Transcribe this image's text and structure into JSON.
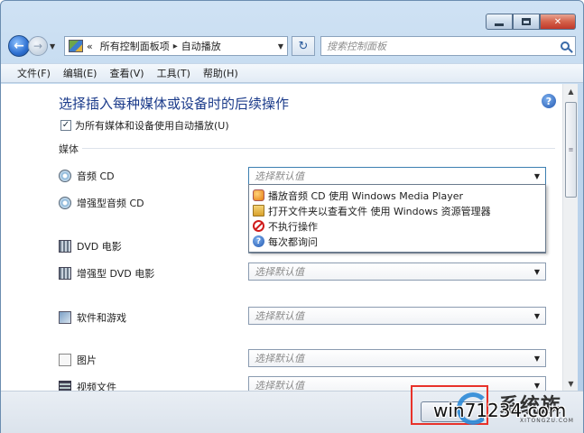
{
  "window": {
    "minimize_icon": "minimize-icon",
    "maximize_icon": "maximize-icon",
    "close_label": "✕"
  },
  "address_bar": {
    "overflow": "«",
    "crumb1": "所有控制面板项",
    "sep": "▸",
    "crumb2": "自动播放",
    "refresh": "↻",
    "search_placeholder": "搜索控制面板"
  },
  "menu": [
    "文件(F)",
    "编辑(E)",
    "查看(V)",
    "工具(T)",
    "帮助(H)"
  ],
  "main": {
    "heading": "选择插入每种媒体或设备时的后续操作",
    "help": "?",
    "autoplay_all_label": "为所有媒体和设备使用自动播放(U)",
    "autoplay_all_checked": true,
    "section_media": "媒体"
  },
  "rows": [
    {
      "label": "音频 CD",
      "value": "选择默认值",
      "icon": "audio-cd-icon"
    },
    {
      "label": "增强型音频 CD",
      "value": "",
      "icon": "enhanced-audio-cd-icon"
    },
    {
      "label": "DVD 电影",
      "value": "",
      "icon": "dvd-movie-icon"
    },
    {
      "label": "增强型 DVD 电影",
      "value": "选择默认值",
      "icon": "enhanced-dvd-icon"
    },
    {
      "label": "软件和游戏",
      "value": "选择默认值",
      "icon": "software-games-icon"
    },
    {
      "label": "图片",
      "value": "选择默认值",
      "icon": "pictures-icon"
    },
    {
      "label": "视频文件",
      "value": "选择默认值",
      "icon": "video-files-icon"
    }
  ],
  "dropdown": {
    "items": [
      {
        "label": "播放音频 CD 使用 Windows Media Player",
        "icon": "media-player-icon"
      },
      {
        "label": "打开文件夹以查看文件 使用 Windows 资源管理器",
        "icon": "folder-icon"
      },
      {
        "label": "不执行操作",
        "icon": "no-action-icon"
      },
      {
        "label": "每次都询问",
        "icon": "ask-icon"
      }
    ]
  },
  "watermark": {
    "brand": "系统族",
    "url": "win71234.com",
    "small": "XITONGZU.COM"
  },
  "colors": {
    "heading": "#1a3a8a",
    "highlight": "#e8322a",
    "window_chrome": "#bcd4ec"
  }
}
